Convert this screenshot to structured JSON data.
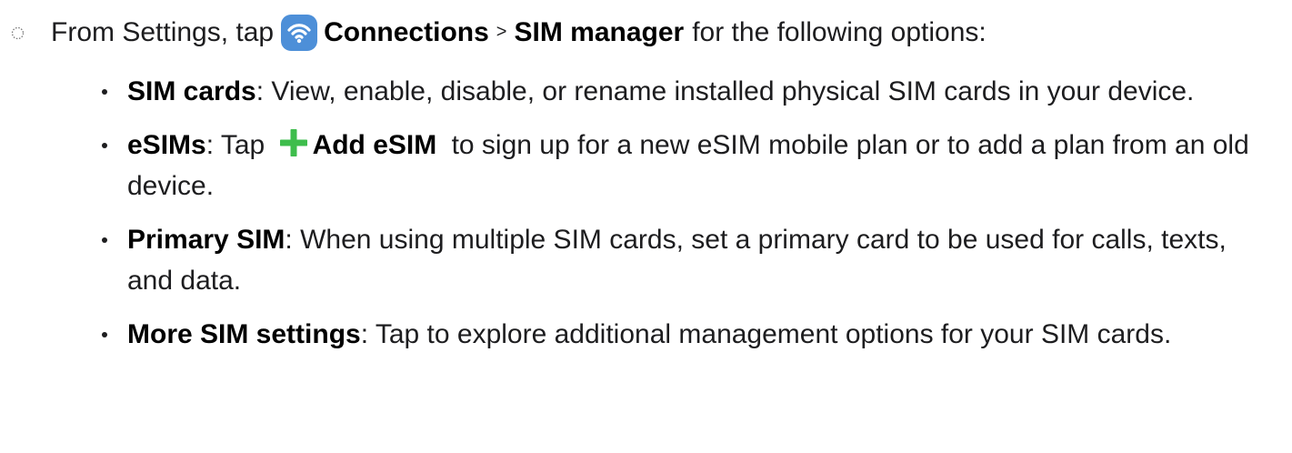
{
  "intro": {
    "prefix": "From Settings, tap",
    "connections": "Connections",
    "separator": ">",
    "sim_manager": "SIM manager",
    "suffix": "for the following options:",
    "bullet_icon": "dotted-circle-icon",
    "connections_icon": "wifi-icon",
    "connections_icon_color": "#4d8fd8"
  },
  "options": [
    {
      "term": "SIM cards",
      "text": ": View, enable, disable, or rename installed physical SIM cards in your device."
    },
    {
      "term": "eSIMs",
      "before": ": Tap",
      "action": "Add eSIM",
      "after": "to sign up for a new eSIM mobile plan or to add a plan from an old device.",
      "action_icon": "plus-icon",
      "action_icon_color": "#3ebd4c"
    },
    {
      "term": "Primary SIM",
      "text": ": When using multiple SIM cards, set a primary card to be used for calls, texts, and data."
    },
    {
      "term": "More SIM settings",
      "text": ": Tap to explore additional management options for your SIM cards."
    }
  ]
}
